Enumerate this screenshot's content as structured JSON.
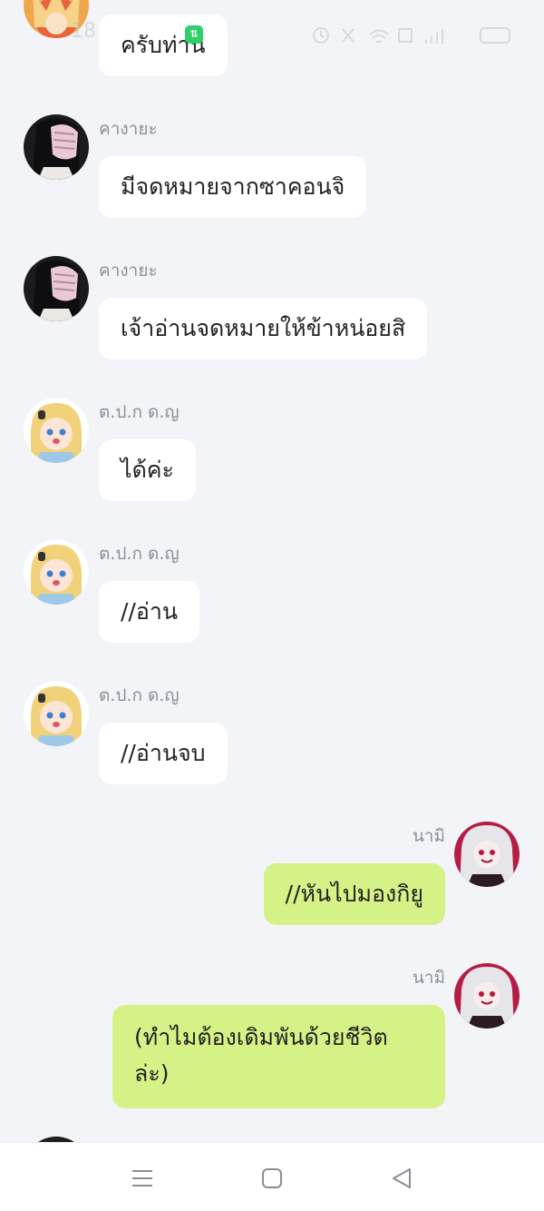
{
  "status_bar": {
    "time": "18",
    "data_badge": "⇅"
  },
  "messages": [
    {
      "side": "left",
      "name": "",
      "text": "ครับท่าน",
      "avatar": "avatar-orange-haired"
    },
    {
      "side": "left",
      "name": "คางายะ",
      "text": "มีจดหมายจากซาคอนจิ",
      "avatar": "avatar-black-haired-bandaged"
    },
    {
      "side": "left",
      "name": "คางายะ",
      "text": "เจ้าอ่านจดหมายให้ข้าหน่อยสิ",
      "avatar": "avatar-black-haired-bandaged"
    },
    {
      "side": "left",
      "name": "ต.ป.ก ด.ญ",
      "text": "ได้ค่ะ",
      "avatar": "avatar-blonde-girl"
    },
    {
      "side": "left",
      "name": "ต.ป.ก ด.ญ",
      "text": "//อ่าน",
      "avatar": "avatar-blonde-girl"
    },
    {
      "side": "left",
      "name": "ต.ป.ก ด.ญ",
      "text": "//อ่านจบ",
      "avatar": "avatar-blonde-girl"
    },
    {
      "side": "right",
      "name": "นามิ",
      "text": "//หันไปมองกิยู",
      "avatar": "avatar-white-haired-red"
    },
    {
      "side": "right",
      "name": "นามิ",
      "text": "(ทำไมต้องเดิมพันด้วยชีวิต ล่ะ)",
      "avatar": "avatar-white-haired-red"
    }
  ],
  "nav_bar": {
    "menu": "menu-icon",
    "home": "home-icon",
    "back": "back-icon"
  },
  "colors": {
    "background": "#f3f4f7",
    "incoming_bubble": "#ffffff",
    "outgoing_bubble": "#d5f287",
    "name_text": "#8a8f99"
  }
}
